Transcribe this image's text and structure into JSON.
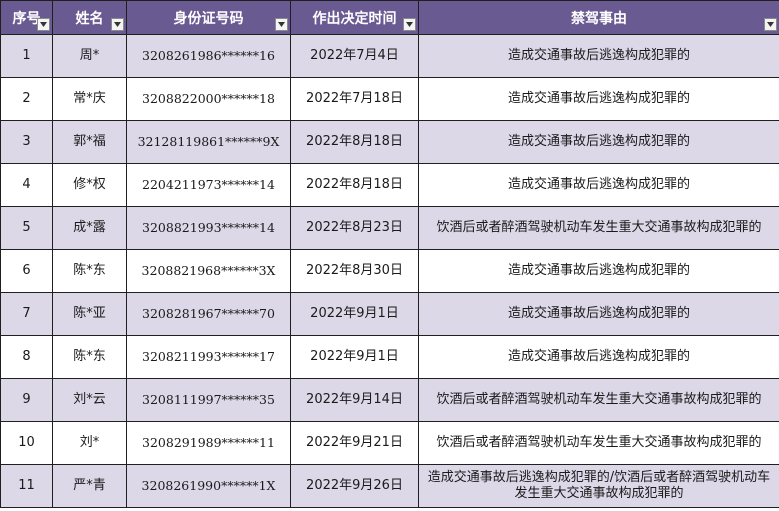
{
  "headers": {
    "seq": "序号",
    "name": "姓名",
    "id": "身份证号码",
    "date": "作出决定时间",
    "reason": "禁驾事由"
  },
  "colors": {
    "header_bg": "#6a5a92",
    "header_text": "#ffffff",
    "odd_row_bg": "#dcd8e8",
    "even_row_bg": "#ffffff"
  },
  "icons": {
    "filter": "filter-dropdown-icon"
  },
  "rows": [
    {
      "seq": "1",
      "name": "周*",
      "id": "3208261986******16",
      "date": "2022年7月4日",
      "reason": "造成交通事故后逃逸构成犯罪的"
    },
    {
      "seq": "2",
      "name": "常*庆",
      "id": "3208822000******18",
      "date": "2022年7月18日",
      "reason": "造成交通事故后逃逸构成犯罪的"
    },
    {
      "seq": "3",
      "name": "郭*福",
      "id": "32128119861******9X",
      "date": "2022年8月18日",
      "reason": "造成交通事故后逃逸构成犯罪的"
    },
    {
      "seq": "4",
      "name": "修*权",
      "id": "2204211973******14",
      "date": "2022年8月18日",
      "reason": "造成交通事故后逃逸构成犯罪的"
    },
    {
      "seq": "5",
      "name": "成*露",
      "id": "3208821993******14",
      "date": "2022年8月23日",
      "reason": "饮酒后或者醉酒驾驶机动车发生重大交通事故构成犯罪的"
    },
    {
      "seq": "6",
      "name": "陈*东",
      "id": "3208821968******3X",
      "date": "2022年8月30日",
      "reason": "造成交通事故后逃逸构成犯罪的"
    },
    {
      "seq": "7",
      "name": "陈*亚",
      "id": "3208281967******70",
      "date": "2022年9月1日",
      "reason": "造成交通事故后逃逸构成犯罪的"
    },
    {
      "seq": "8",
      "name": "陈*东",
      "id": "3208211993******17",
      "date": "2022年9月1日",
      "reason": "造成交通事故后逃逸构成犯罪的"
    },
    {
      "seq": "9",
      "name": "刘*云",
      "id": "3208111997******35",
      "date": "2022年9月14日",
      "reason": "饮酒后或者醉酒驾驶机动车发生重大交通事故构成犯罪的"
    },
    {
      "seq": "10",
      "name": "刘*",
      "id": "3208291989******11",
      "date": "2022年9月21日",
      "reason": "饮酒后或者醉酒驾驶机动车发生重大交通事故构成犯罪的"
    },
    {
      "seq": "11",
      "name": "严*青",
      "id": "3208261990******1X",
      "date": "2022年9月26日",
      "reason": "造成交通事故后逃逸构成犯罪的/饮酒后或者醉酒驾驶机动车发生重大交通事故构成犯罪的"
    }
  ]
}
